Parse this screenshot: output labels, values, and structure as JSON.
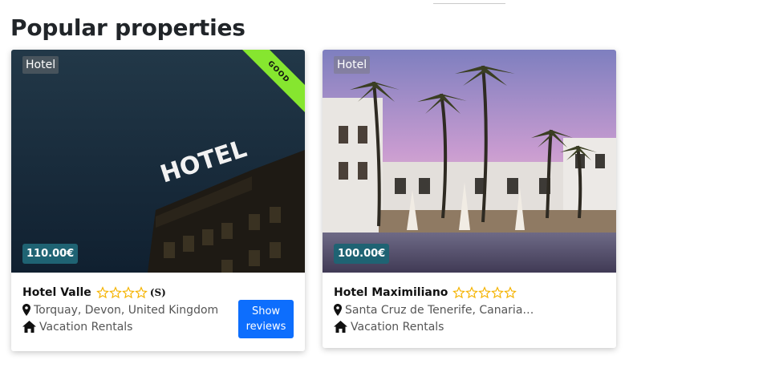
{
  "section": {
    "title": "Popular properties"
  },
  "properties": [
    {
      "type_badge": "Hotel",
      "ribbon": "GOOD",
      "price": "110.00€",
      "name": "Hotel Valle",
      "stars_total": 4,
      "star_rating_tag": "(S)",
      "location": "Torquay, Devon, United Kingdom",
      "category": "Vacation Rentals",
      "reviews_button": "Show reviews",
      "image_icon": "hotel-building-photo"
    },
    {
      "type_badge": "Hotel",
      "price": "100.00€",
      "name": "Hotel Maximiliano",
      "stars_total": 5,
      "location": "Santa Cruz de Tenerife, Canarias, S...",
      "category": "Vacation Rentals",
      "image_icon": "palm-resort-photo"
    }
  ],
  "colors": {
    "price_badge": "#1f6373",
    "ribbon": "#86e62f",
    "button": "#0d6efd",
    "star_outline": "#f5b301"
  }
}
